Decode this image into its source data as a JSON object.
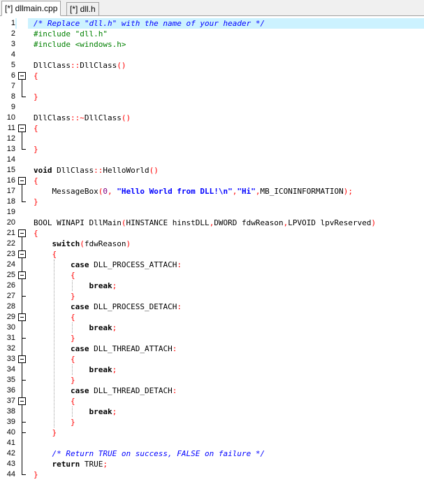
{
  "tabs": [
    {
      "label": "[*] dllmain.cpp",
      "active": true
    },
    {
      "label": "[*] dll.h",
      "active": false
    }
  ],
  "editor": {
    "active_line": 1,
    "lines": [
      {
        "n": "1",
        "tokens": [
          [
            "c",
            "/* Replace \"dll.h\" with the name of your header */"
          ]
        ]
      },
      {
        "n": "2",
        "tokens": [
          [
            "p",
            "#include \"dll.h\""
          ]
        ]
      },
      {
        "n": "3",
        "tokens": [
          [
            "p",
            "#include <windows.h>"
          ]
        ]
      },
      {
        "n": "4",
        "tokens": []
      },
      {
        "n": "5",
        "tokens": [
          [
            "t",
            "DllClass"
          ],
          [
            "o",
            "::"
          ],
          [
            "t",
            "DllClass"
          ],
          [
            "o",
            "()"
          ]
        ]
      },
      {
        "n": "6",
        "tokens": [
          [
            "o",
            "{"
          ]
        ]
      },
      {
        "n": "7",
        "tokens": []
      },
      {
        "n": "8",
        "tokens": [
          [
            "o",
            "}"
          ]
        ]
      },
      {
        "n": "9",
        "tokens": []
      },
      {
        "n": "10",
        "tokens": [
          [
            "t",
            "DllClass"
          ],
          [
            "o",
            "::~"
          ],
          [
            "t",
            "DllClass"
          ],
          [
            "o",
            "()"
          ]
        ]
      },
      {
        "n": "11",
        "tokens": [
          [
            "o",
            "{"
          ]
        ]
      },
      {
        "n": "12",
        "tokens": []
      },
      {
        "n": "13",
        "tokens": [
          [
            "o",
            "}"
          ]
        ]
      },
      {
        "n": "14",
        "tokens": []
      },
      {
        "n": "15",
        "tokens": [
          [
            "k",
            "void"
          ],
          [
            "t",
            " DllClass"
          ],
          [
            "o",
            "::"
          ],
          [
            "t",
            "HelloWorld"
          ],
          [
            "o",
            "()"
          ]
        ]
      },
      {
        "n": "16",
        "tokens": [
          [
            "o",
            "{"
          ]
        ]
      },
      {
        "n": "17",
        "tokens": [
          [
            "t",
            "    MessageBox"
          ],
          [
            "o",
            "("
          ],
          [
            "n",
            "0"
          ],
          [
            "o",
            ", "
          ],
          [
            "s",
            "\"Hello World from DLL!\\n\""
          ],
          [
            "o",
            ","
          ],
          [
            "s",
            "\"Hi\""
          ],
          [
            "o",
            ","
          ],
          [
            "t",
            "MB_ICONINFORMATION"
          ],
          [
            "o",
            ");"
          ]
        ]
      },
      {
        "n": "18",
        "tokens": [
          [
            "o",
            "}"
          ]
        ]
      },
      {
        "n": "19",
        "tokens": []
      },
      {
        "n": "20",
        "tokens": [
          [
            "t",
            "BOOL WINAPI DllMain"
          ],
          [
            "o",
            "("
          ],
          [
            "t",
            "HINSTANCE hinstDLL"
          ],
          [
            "o",
            ","
          ],
          [
            "t",
            "DWORD fdwReason"
          ],
          [
            "o",
            ","
          ],
          [
            "t",
            "LPVOID lpvReserved"
          ],
          [
            "o",
            ")"
          ]
        ]
      },
      {
        "n": "21",
        "tokens": [
          [
            "o",
            "{"
          ]
        ]
      },
      {
        "n": "22",
        "tokens": [
          [
            "t",
            "    "
          ],
          [
            "k",
            "switch"
          ],
          [
            "o",
            "("
          ],
          [
            "t",
            "fdwReason"
          ],
          [
            "o",
            ")"
          ]
        ]
      },
      {
        "n": "23",
        "tokens": [
          [
            "o",
            "    {"
          ]
        ]
      },
      {
        "n": "24",
        "tokens": [
          [
            "t",
            "        "
          ],
          [
            "k",
            "case"
          ],
          [
            "t",
            " DLL_PROCESS_ATTACH"
          ],
          [
            "o",
            ":"
          ]
        ]
      },
      {
        "n": "25",
        "tokens": [
          [
            "o",
            "        {"
          ]
        ]
      },
      {
        "n": "26",
        "tokens": [
          [
            "t",
            "            "
          ],
          [
            "k",
            "break"
          ],
          [
            "o",
            ";"
          ]
        ]
      },
      {
        "n": "27",
        "tokens": [
          [
            "o",
            "        }"
          ]
        ]
      },
      {
        "n": "28",
        "tokens": [
          [
            "t",
            "        "
          ],
          [
            "k",
            "case"
          ],
          [
            "t",
            " DLL_PROCESS_DETACH"
          ],
          [
            "o",
            ":"
          ]
        ]
      },
      {
        "n": "29",
        "tokens": [
          [
            "o",
            "        {"
          ]
        ]
      },
      {
        "n": "30",
        "tokens": [
          [
            "t",
            "            "
          ],
          [
            "k",
            "break"
          ],
          [
            "o",
            ";"
          ]
        ]
      },
      {
        "n": "31",
        "tokens": [
          [
            "o",
            "        }"
          ]
        ]
      },
      {
        "n": "32",
        "tokens": [
          [
            "t",
            "        "
          ],
          [
            "k",
            "case"
          ],
          [
            "t",
            " DLL_THREAD_ATTACH"
          ],
          [
            "o",
            ":"
          ]
        ]
      },
      {
        "n": "33",
        "tokens": [
          [
            "o",
            "        {"
          ]
        ]
      },
      {
        "n": "34",
        "tokens": [
          [
            "t",
            "            "
          ],
          [
            "k",
            "break"
          ],
          [
            "o",
            ";"
          ]
        ]
      },
      {
        "n": "35",
        "tokens": [
          [
            "o",
            "        }"
          ]
        ]
      },
      {
        "n": "36",
        "tokens": [
          [
            "t",
            "        "
          ],
          [
            "k",
            "case"
          ],
          [
            "t",
            " DLL_THREAD_DETACH"
          ],
          [
            "o",
            ":"
          ]
        ]
      },
      {
        "n": "37",
        "tokens": [
          [
            "o",
            "        {"
          ]
        ]
      },
      {
        "n": "38",
        "tokens": [
          [
            "t",
            "            "
          ],
          [
            "k",
            "break"
          ],
          [
            "o",
            ";"
          ]
        ]
      },
      {
        "n": "39",
        "tokens": [
          [
            "o",
            "        }"
          ]
        ]
      },
      {
        "n": "40",
        "tokens": [
          [
            "o",
            "    }"
          ]
        ]
      },
      {
        "n": "41",
        "tokens": []
      },
      {
        "n": "42",
        "tokens": [
          [
            "c",
            "    /* Return TRUE on success, FALSE on failure */"
          ]
        ]
      },
      {
        "n": "43",
        "tokens": [
          [
            "t",
            "    "
          ],
          [
            "k",
            "return"
          ],
          [
            "t",
            " TRUE"
          ],
          [
            "o",
            ";"
          ]
        ]
      },
      {
        "n": "44",
        "tokens": [
          [
            "o",
            "}"
          ]
        ]
      }
    ],
    "folds": [
      {
        "start": 6,
        "end": 8
      },
      {
        "start": 11,
        "end": 13
      },
      {
        "start": 16,
        "end": 18
      },
      {
        "start": 21,
        "end": 44
      },
      {
        "start": 23,
        "end": 40
      },
      {
        "start": 25,
        "end": 27
      },
      {
        "start": 29,
        "end": 31
      },
      {
        "start": 33,
        "end": 35
      },
      {
        "start": 37,
        "end": 39
      }
    ]
  }
}
